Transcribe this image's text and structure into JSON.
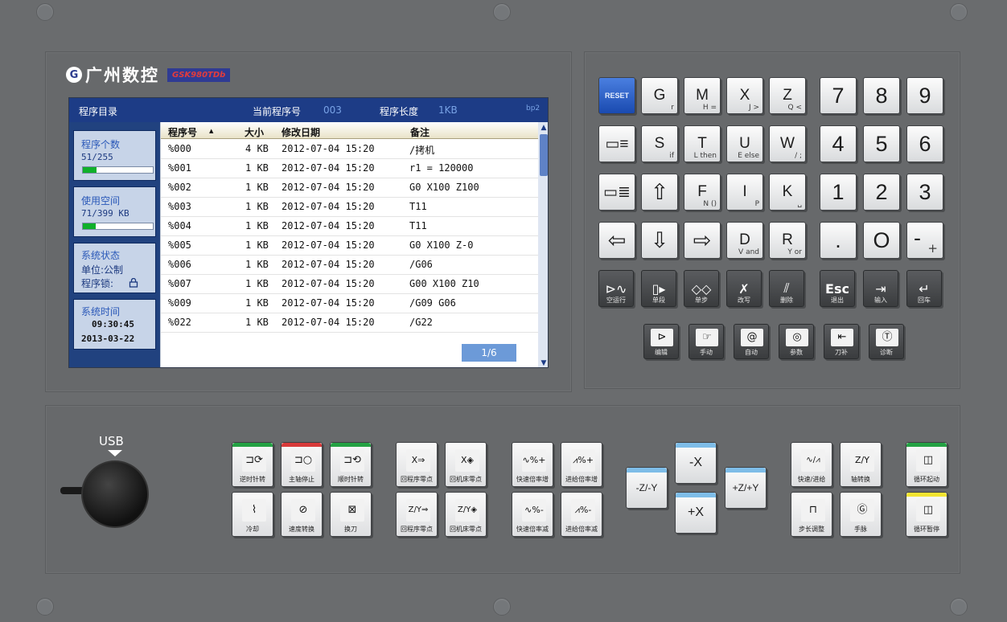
{
  "brand": {
    "logo": "G",
    "name": "广州数控",
    "model": "GSK980TDb"
  },
  "screen": {
    "header": {
      "title": "程序目录",
      "current_label": "当前程序号",
      "current_value": "003",
      "length_label": "程序长度",
      "length_value": "1KB",
      "code": "bp2"
    },
    "left": {
      "program_count": {
        "label": "程序个数",
        "value": "51/255",
        "fill": 0.2
      },
      "used_space": {
        "label": "使用空间",
        "value": "71/399 KB",
        "fill": 0.18
      },
      "system_status": {
        "label": "系统状态",
        "unit_line": "单位:公制",
        "lock_line": "程序锁:"
      },
      "system_time": {
        "label": "系统时间",
        "time": "09:30:45",
        "date": "2013-03-22"
      }
    },
    "columns": [
      "程序号",
      "大小",
      "修改日期",
      "备注"
    ],
    "rows": [
      {
        "no": "%000",
        "size": "4 KB",
        "date": "2012-07-04 15:20",
        "note": "/拷机"
      },
      {
        "no": "%001",
        "size": "1 KB",
        "date": "2012-07-04 15:20",
        "note": "r1 = 120000"
      },
      {
        "no": "%002",
        "size": "1 KB",
        "date": "2012-07-04 15:20",
        "note": "G0 X100 Z100"
      },
      {
        "no": "%003",
        "size": "1 KB",
        "date": "2012-07-04 15:20",
        "note": "T11"
      },
      {
        "no": "%004",
        "size": "1 KB",
        "date": "2012-07-04 15:20",
        "note": "T11"
      },
      {
        "no": "%005",
        "size": "1 KB",
        "date": "2012-07-04 15:20",
        "note": "G0 X100 Z-0"
      },
      {
        "no": "%006",
        "size": "1 KB",
        "date": "2012-07-04 15:20",
        "note": "/G06"
      },
      {
        "no": "%007",
        "size": "1 KB",
        "date": "2012-07-04 15:20",
        "note": "G00 X100 Z10"
      },
      {
        "no": "%009",
        "size": "1 KB",
        "date": "2012-07-04 15:20",
        "note": "/G09 G06"
      },
      {
        "no": "%022",
        "size": "1 KB",
        "date": "2012-07-04 15:20",
        "note": "/G22"
      }
    ],
    "page": "1/6"
  },
  "keypad": {
    "reset": "RESET",
    "letters": [
      {
        "main": "G",
        "sub": "r"
      },
      {
        "main": "M",
        "sub": "H ="
      },
      {
        "main": "X",
        "sub": "J >"
      },
      {
        "main": "Z",
        "sub": "Q <"
      },
      {
        "main": "S",
        "sub": "if"
      },
      {
        "main": "T",
        "sub": "L then"
      },
      {
        "main": "U",
        "sub": "E else"
      },
      {
        "main": "W",
        "sub": "/ ;"
      },
      {
        "main": "F",
        "sub": "N ()"
      },
      {
        "main": "I",
        "sub": "P"
      },
      {
        "main": "K",
        "sub": "␣"
      },
      {
        "main": "D",
        "sub": "V and"
      },
      {
        "main": "R",
        "sub": "Y or"
      }
    ],
    "numbers": [
      "7",
      "8",
      "9",
      "4",
      "5",
      "6",
      "1",
      "2",
      "3"
    ],
    "symbols": [
      ".",
      "O",
      "-",
      "+"
    ],
    "function_keys": [
      {
        "icon": "▭≡",
        "caption": ""
      },
      {
        "icon": "▭≣",
        "caption": ""
      },
      {
        "icon": "⇦",
        "caption": ""
      },
      {
        "icon": "⇧",
        "caption": ""
      },
      {
        "icon": "⇩",
        "caption": ""
      },
      {
        "icon": "⇨",
        "caption": ""
      }
    ],
    "op_keys": [
      {
        "icon": "⊳∿",
        "caption": "空运行"
      },
      {
        "icon": "▯▸",
        "caption": "单段"
      },
      {
        "icon": "◇◇",
        "caption": "单步"
      },
      {
        "icon": "✗",
        "caption": "改写"
      },
      {
        "icon": "⫽",
        "caption": "删除"
      },
      {
        "icon": "Esc",
        "caption": "退出"
      },
      {
        "icon": "⇥",
        "caption": "输入"
      },
      {
        "icon": "↵",
        "caption": "回车"
      }
    ],
    "mode_keys": [
      {
        "icon": "⊳",
        "caption": "编辑"
      },
      {
        "icon": "☞",
        "caption": "手动"
      },
      {
        "icon": "@",
        "caption": "自动"
      },
      {
        "icon": "◎",
        "caption": "参数"
      },
      {
        "icon": "⇤",
        "caption": "刀补"
      },
      {
        "icon": "Ⓣ",
        "caption": "诊断"
      }
    ]
  },
  "usb": {
    "label": "USB"
  },
  "bottom": {
    "group1": [
      {
        "icon": "⊐⟳",
        "caption": "逆时针转",
        "color": "#24a244"
      },
      {
        "icon": "⊐○",
        "caption": "主轴停止",
        "color": "#d83a3a"
      },
      {
        "icon": "⊐⟲",
        "caption": "顺时针转",
        "color": "#24a244"
      },
      {
        "icon": "⌇",
        "caption": "冷却",
        "color": ""
      },
      {
        "icon": "⊘",
        "caption": "速度转换",
        "color": ""
      },
      {
        "icon": "⊠",
        "caption": "换刀",
        "color": ""
      }
    ],
    "group2": [
      {
        "icon": "X⇒",
        "caption": "回程序零点"
      },
      {
        "icon": "X◈",
        "caption": "回机床零点"
      },
      {
        "icon": "Z/Y⇒",
        "caption": "回程序零点"
      },
      {
        "icon": "Z/Y◈",
        "caption": "回机床零点"
      }
    ],
    "group3": [
      {
        "icon": "∿%+",
        "caption": "快速倍率增"
      },
      {
        "icon": "⩘%+",
        "caption": "进给倍率增"
      },
      {
        "icon": "∿%-",
        "caption": "快速倍率减"
      },
      {
        "icon": "⩘%-",
        "caption": "进给倍率减"
      }
    ],
    "axis": {
      "minus_x": "-X",
      "plus_x": "+X",
      "minus_z": "-Z/-Y",
      "plus_z": "+Z/+Y"
    },
    "group4": [
      {
        "icon": "∿/⩘",
        "caption": "快速/进给"
      },
      {
        "icon": "Z/Y",
        "caption": "轴转换"
      },
      {
        "icon": "⊓",
        "caption": "步长调整"
      },
      {
        "icon": "Ⓖ",
        "caption": "手脉"
      }
    ],
    "cycle": [
      {
        "icon": "◫",
        "caption": "循环起动",
        "color": "#24a244"
      },
      {
        "icon": "◫",
        "caption": "循环暂停",
        "color": "#f2e430"
      }
    ]
  }
}
